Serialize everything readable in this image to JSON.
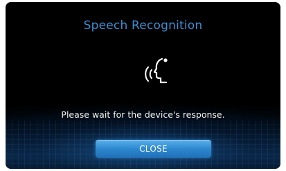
{
  "dialog": {
    "title": "Speech Recognition",
    "icon": "speech-recognition-icon",
    "message": "Please wait for the device's response.",
    "close_label": "CLOSE"
  },
  "colors": {
    "title": "#3d8fd3",
    "button": "#2e88cf",
    "background": "#000000"
  }
}
